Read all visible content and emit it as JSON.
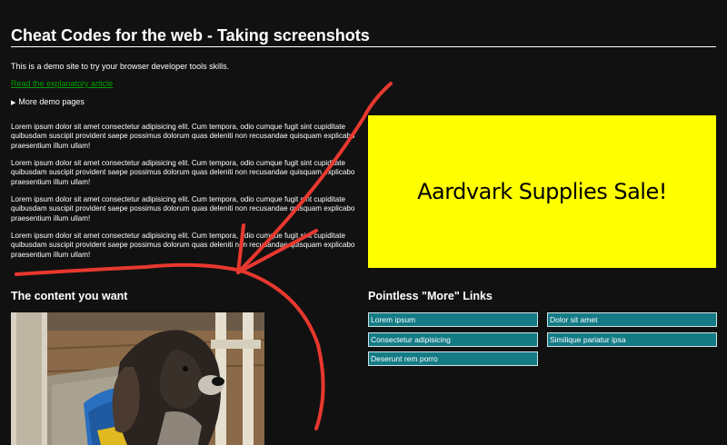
{
  "header": {
    "title": "Cheat Codes for the web - Taking screenshots"
  },
  "intro": {
    "text": "This is a demo site to try your browser developer tools skills.",
    "article_link": "Read the explanatory article",
    "details_summary": "More demo pages"
  },
  "lorem_paragraphs": [
    "Lorem ipsum dolor sit amet consectetur adipisicing elit. Cum tempora, odio cumque fugit sint cupiditate quibusdam suscipit provident saepe possimus dolorum quas deleniti non recusandae quisquam explicabo praesentium illum ullam!",
    "Lorem ipsum dolor sit amet consectetur adipisicing elit. Cum tempora, odio cumque fugit sint cupiditate quibusdam suscipit provident saepe possimus dolorum quas deleniti non recusandae quisquam explicabo praesentium illum ullam!",
    "Lorem ipsum dolor sit amet consectetur adipisicing elit. Cum tempora, odio cumque fugit sint cupiditate quibusdam suscipit provident saepe possimus dolorum quas deleniti non recusandae quisquam explicabo praesentium illum ullam!",
    "Lorem ipsum dolor sit amet consectetur adipisicing elit. Cum tempora, odio cumque fugit sint cupiditate quibusdam suscipit provident saepe possimus dolorum quas deleniti non recusandae quisquam explicabo praesentium illum ullam!"
  ],
  "banner": {
    "text": "Aardvark Supplies Sale!",
    "background": "#ffff00"
  },
  "content_section": {
    "heading": "The content you want"
  },
  "more_links": {
    "heading": "Pointless \"More\" Links",
    "items": [
      "Lorem ipsum",
      "Dolor sit amet",
      "Consectetur adipisicing",
      "Similique pariatur ipsa",
      "Deserunt rem porro"
    ]
  },
  "colors": {
    "background": "#111111",
    "link": "#00a000",
    "more_link_bg": "#147b85",
    "annotation": "#e8382f"
  },
  "icons": {
    "details_marker": "triangle-right-icon",
    "annotation": "arrow-scribble-icon"
  }
}
